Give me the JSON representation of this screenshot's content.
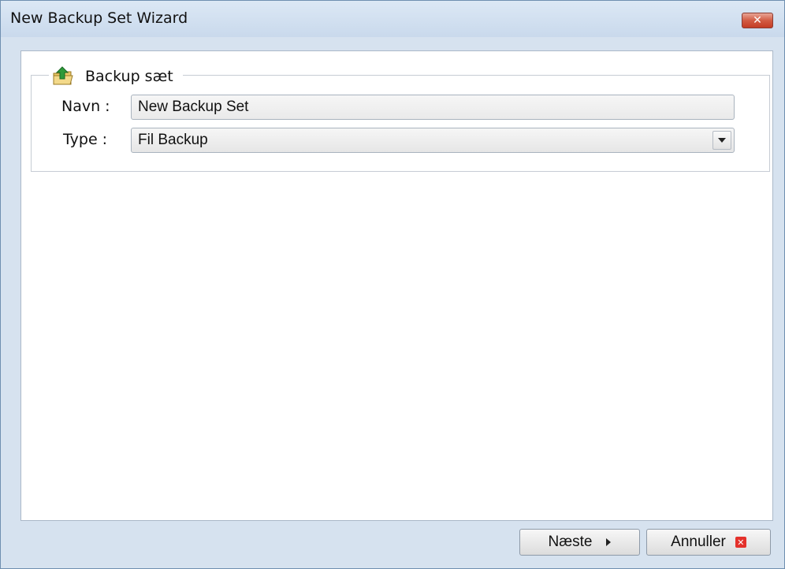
{
  "window": {
    "title": "New Backup Set Wizard",
    "close_glyph": "✕"
  },
  "group": {
    "label": "Backup sæt",
    "icon": "folder-upload-icon"
  },
  "form": {
    "name_label": "Navn :",
    "name_value": "New Backup Set",
    "type_label": "Type :",
    "type_value": "Fil Backup"
  },
  "buttons": {
    "next_label": "Næste",
    "cancel_label": "Annuller",
    "cancel_glyph": "✕"
  },
  "colors": {
    "window_frame": "#d6e2ef",
    "close_button": "#c43c24",
    "cancel_icon": "#e4312b"
  }
}
